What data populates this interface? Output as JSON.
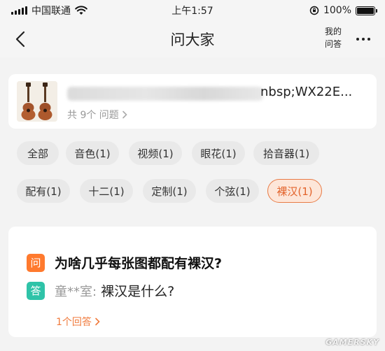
{
  "status_bar": {
    "carrier": "中国联通",
    "time": "上午1:57",
    "battery_percent": "100%",
    "battery_level": 1.0,
    "wifi_icon": "wifi-icon",
    "lock_icon": "orientation-lock-icon"
  },
  "nav": {
    "title": "问大家",
    "my_questions_line1": "我的",
    "my_questions_line2": "问答",
    "back_icon": "back-arrow-icon",
    "more_icon": "more-dots-icon"
  },
  "product": {
    "title_visible_part": "nbsp;WX22E...",
    "question_count": "共 9个 问题",
    "title_blurred": true
  },
  "tags": [
    {
      "label": "全部",
      "active": false
    },
    {
      "label": "音色(1)",
      "active": false
    },
    {
      "label": "视频(1)",
      "active": false
    },
    {
      "label": "眼花(1)",
      "active": false
    },
    {
      "label": "拾音器(1)",
      "active": false
    },
    {
      "label": "配有(1)",
      "active": false
    },
    {
      "label": "十二(1)",
      "active": false
    },
    {
      "label": "定制(1)",
      "active": false
    },
    {
      "label": "个弦(1)",
      "active": false
    },
    {
      "label": "裸汉(1)",
      "active": true
    }
  ],
  "qa": {
    "question_badge": "问",
    "question": "为啥几乎每张图都配有裸汉?",
    "answer_badge": "答",
    "answerer": "童**室:",
    "answer": "裸汉是什么?",
    "answer_count_link": "1个回答"
  },
  "colors": {
    "accent_orange": "#ff7a2e",
    "answer_green": "#2fc3a8",
    "active_tag_bg": "#fde6d9",
    "active_tag_text": "#e3632b"
  },
  "watermark": "GAMERSKY"
}
